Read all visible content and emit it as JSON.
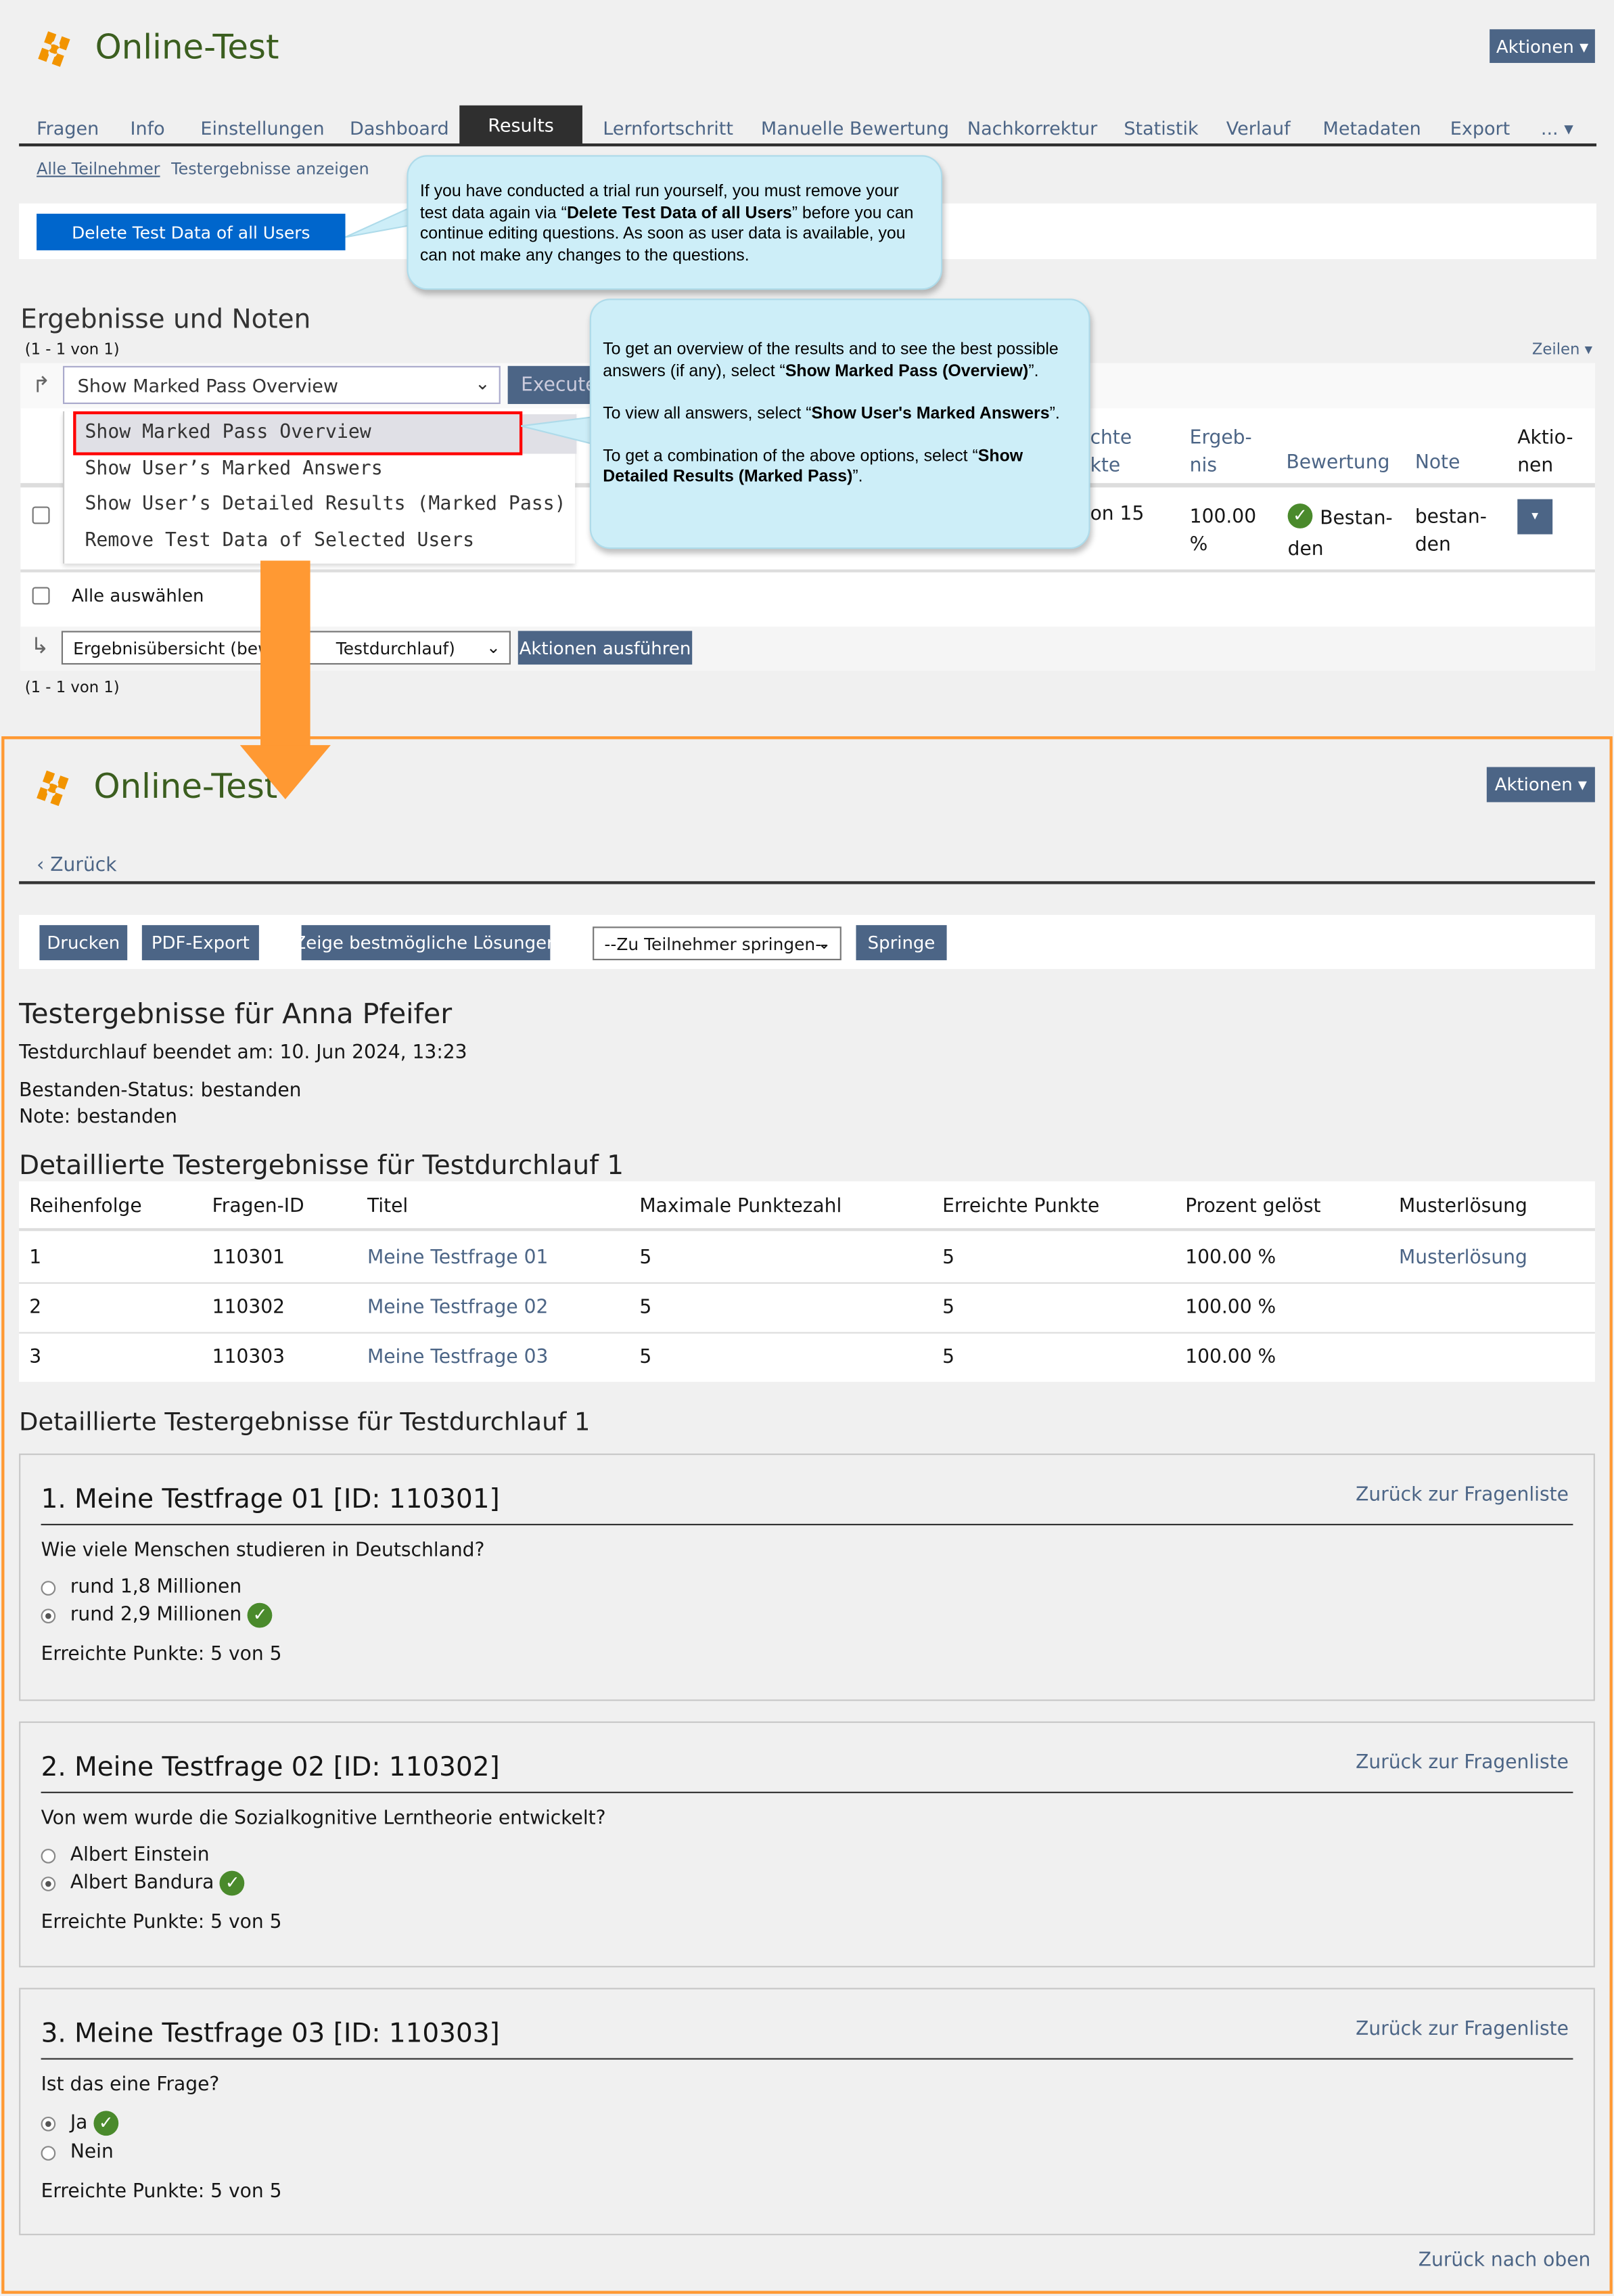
{
  "top": {
    "app_title": "Online-Test",
    "actions_button": "Aktionen",
    "tabs": [
      "Fragen",
      "Info",
      "Einstellungen",
      "Dashboard",
      "Results",
      "Lernfortschritt",
      "Manuelle Bewertung",
      "Nachkorrektur",
      "Statistik",
      "Verlauf",
      "Metadaten",
      "Export",
      "..."
    ],
    "active_tab": "Results",
    "subtabs": [
      "Alle Teilnehmer",
      "Testergebnisse anzeigen"
    ],
    "delete_button": "Delete Test Data of all Users",
    "tooltip1": {
      "pre": "If you have conducted a trial run yourself, you must remove your test data again via “",
      "bold": "Delete Test Data of all Users",
      "post": "” before you can continue editing questions. As soon as user data is available, you can not make any changes to the questions."
    },
    "section_title": "Ergebnisse und Noten",
    "pagination": "(1 - 1 von 1)",
    "rows_label": "Zeilen",
    "select_value": "Show Marked Pass Overview",
    "execute_button": "Execute",
    "dropdown_options": [
      "Show Marked Pass Overview",
      "Show User’s Marked Answers",
      "Show User’s Detailed Results (Marked Pass)",
      "Remove Test Data of Selected Users"
    ],
    "tooltip2": {
      "p1_pre": "To get an overview of the results and to see the best possible answers (if any), select “",
      "p1_bold": "Show Marked Pass (Overview)",
      "p1_post": "”.",
      "p2_pre": "To view all answers, select “",
      "p2_bold": "Show User's Marked Answers",
      "p2_post": "”.",
      "p3_pre": "To get a combination of the above options, select “",
      "p3_bold": "Show Detailed Results (Marked Pass)",
      "p3_post": "”."
    },
    "columns": {
      "points_partial": "chte\nkte",
      "result": "Ergeb-\nnis",
      "rating": "Bewertung",
      "grade": "Note",
      "actions": "Aktio-\nnen"
    },
    "row": {
      "points_partial": "on 15",
      "result": "100.00\n%",
      "rating": "Bestan-\nden",
      "grade": "bestan-\nden"
    },
    "select_all": "Alle auswählen",
    "bottom_select": "Ergebnisübersicht (bewertete Testdurchlauf)",
    "bottom_select_visible_left": "Ergebnisübersicht (bewe",
    "bottom_select_visible_right": "Testdurchlauf)",
    "run_actions_button": "Aktionen ausführen",
    "pagination_bottom": "(1 - 1 von 1)"
  },
  "bottom": {
    "app_title": "Online-Test",
    "actions_button": "Aktionen",
    "back_link": "Zurück",
    "toolbar": {
      "print": "Drucken",
      "pdf": "PDF-Export",
      "best": "Zeige bestmögliche Lösungen",
      "jump_select": "--Zu Teilnehmer springen--",
      "jump": "Springe"
    },
    "heading": "Testergebnisse für Anna Pfeifer",
    "finished": "Testdurchlauf beendet am: 10. Jun 2024, 13:23",
    "status": "Bestanden-Status: bestanden",
    "grade": "Note: bestanden",
    "table_title": "Detaillierte Testergebnisse für Testdurchlauf 1",
    "table_headers": [
      "Reihenfolge",
      "Fragen-ID",
      "Titel",
      "Maximale Punktezahl",
      "Erreichte Punkte",
      "Prozent gelöst",
      "Musterlösung"
    ],
    "table_rows": [
      [
        "1",
        "110301",
        "Meine Testfrage 01",
        "5",
        "5",
        "100.00 %",
        "Musterlösung"
      ],
      [
        "2",
        "110302",
        "Meine Testfrage 02",
        "5",
        "5",
        "100.00 %",
        ""
      ],
      [
        "3",
        "110303",
        "Meine Testfrage 03",
        "5",
        "5",
        "100.00 %",
        ""
      ]
    ],
    "details_title": "Detaillierte Testergebnisse für Testdurchlauf 1",
    "back_to_list": "Zurück zur Fragenliste",
    "questions": [
      {
        "title": "1. Meine Testfrage 01 [ID: 110301]",
        "question": "Wie viele Menschen studieren in Deutschland?",
        "options": [
          "rund 1,8 Millionen",
          "rund 2,9 Millionen"
        ],
        "selected": 1,
        "points": "Erreichte Punkte: 5 von 5"
      },
      {
        "title": "2. Meine Testfrage 02 [ID: 110302]",
        "question": "Von wem wurde die Sozialkognitive Lerntheorie entwickelt?",
        "options": [
          "Albert Einstein",
          "Albert Bandura"
        ],
        "selected": 1,
        "points": "Erreichte Punkte: 5 von 5"
      },
      {
        "title": "3. Meine Testfrage 03 [ID: 110303]",
        "question": "Ist das eine Frage?",
        "options": [
          "Ja",
          "Nein"
        ],
        "selected": 0,
        "points": "Erreichte Punkte: 5 von 5"
      }
    ],
    "back_to_top": "Zurück nach oben"
  },
  "colors": {
    "accent": "#4c6586",
    "brand_green": "#3b5e1f",
    "logo_orange": "#f29400",
    "arrow_orange": "#ff9933",
    "tooltip": "#cdeef8",
    "highlight_red": "#ff0000",
    "delete_blue": "#0066cc"
  }
}
